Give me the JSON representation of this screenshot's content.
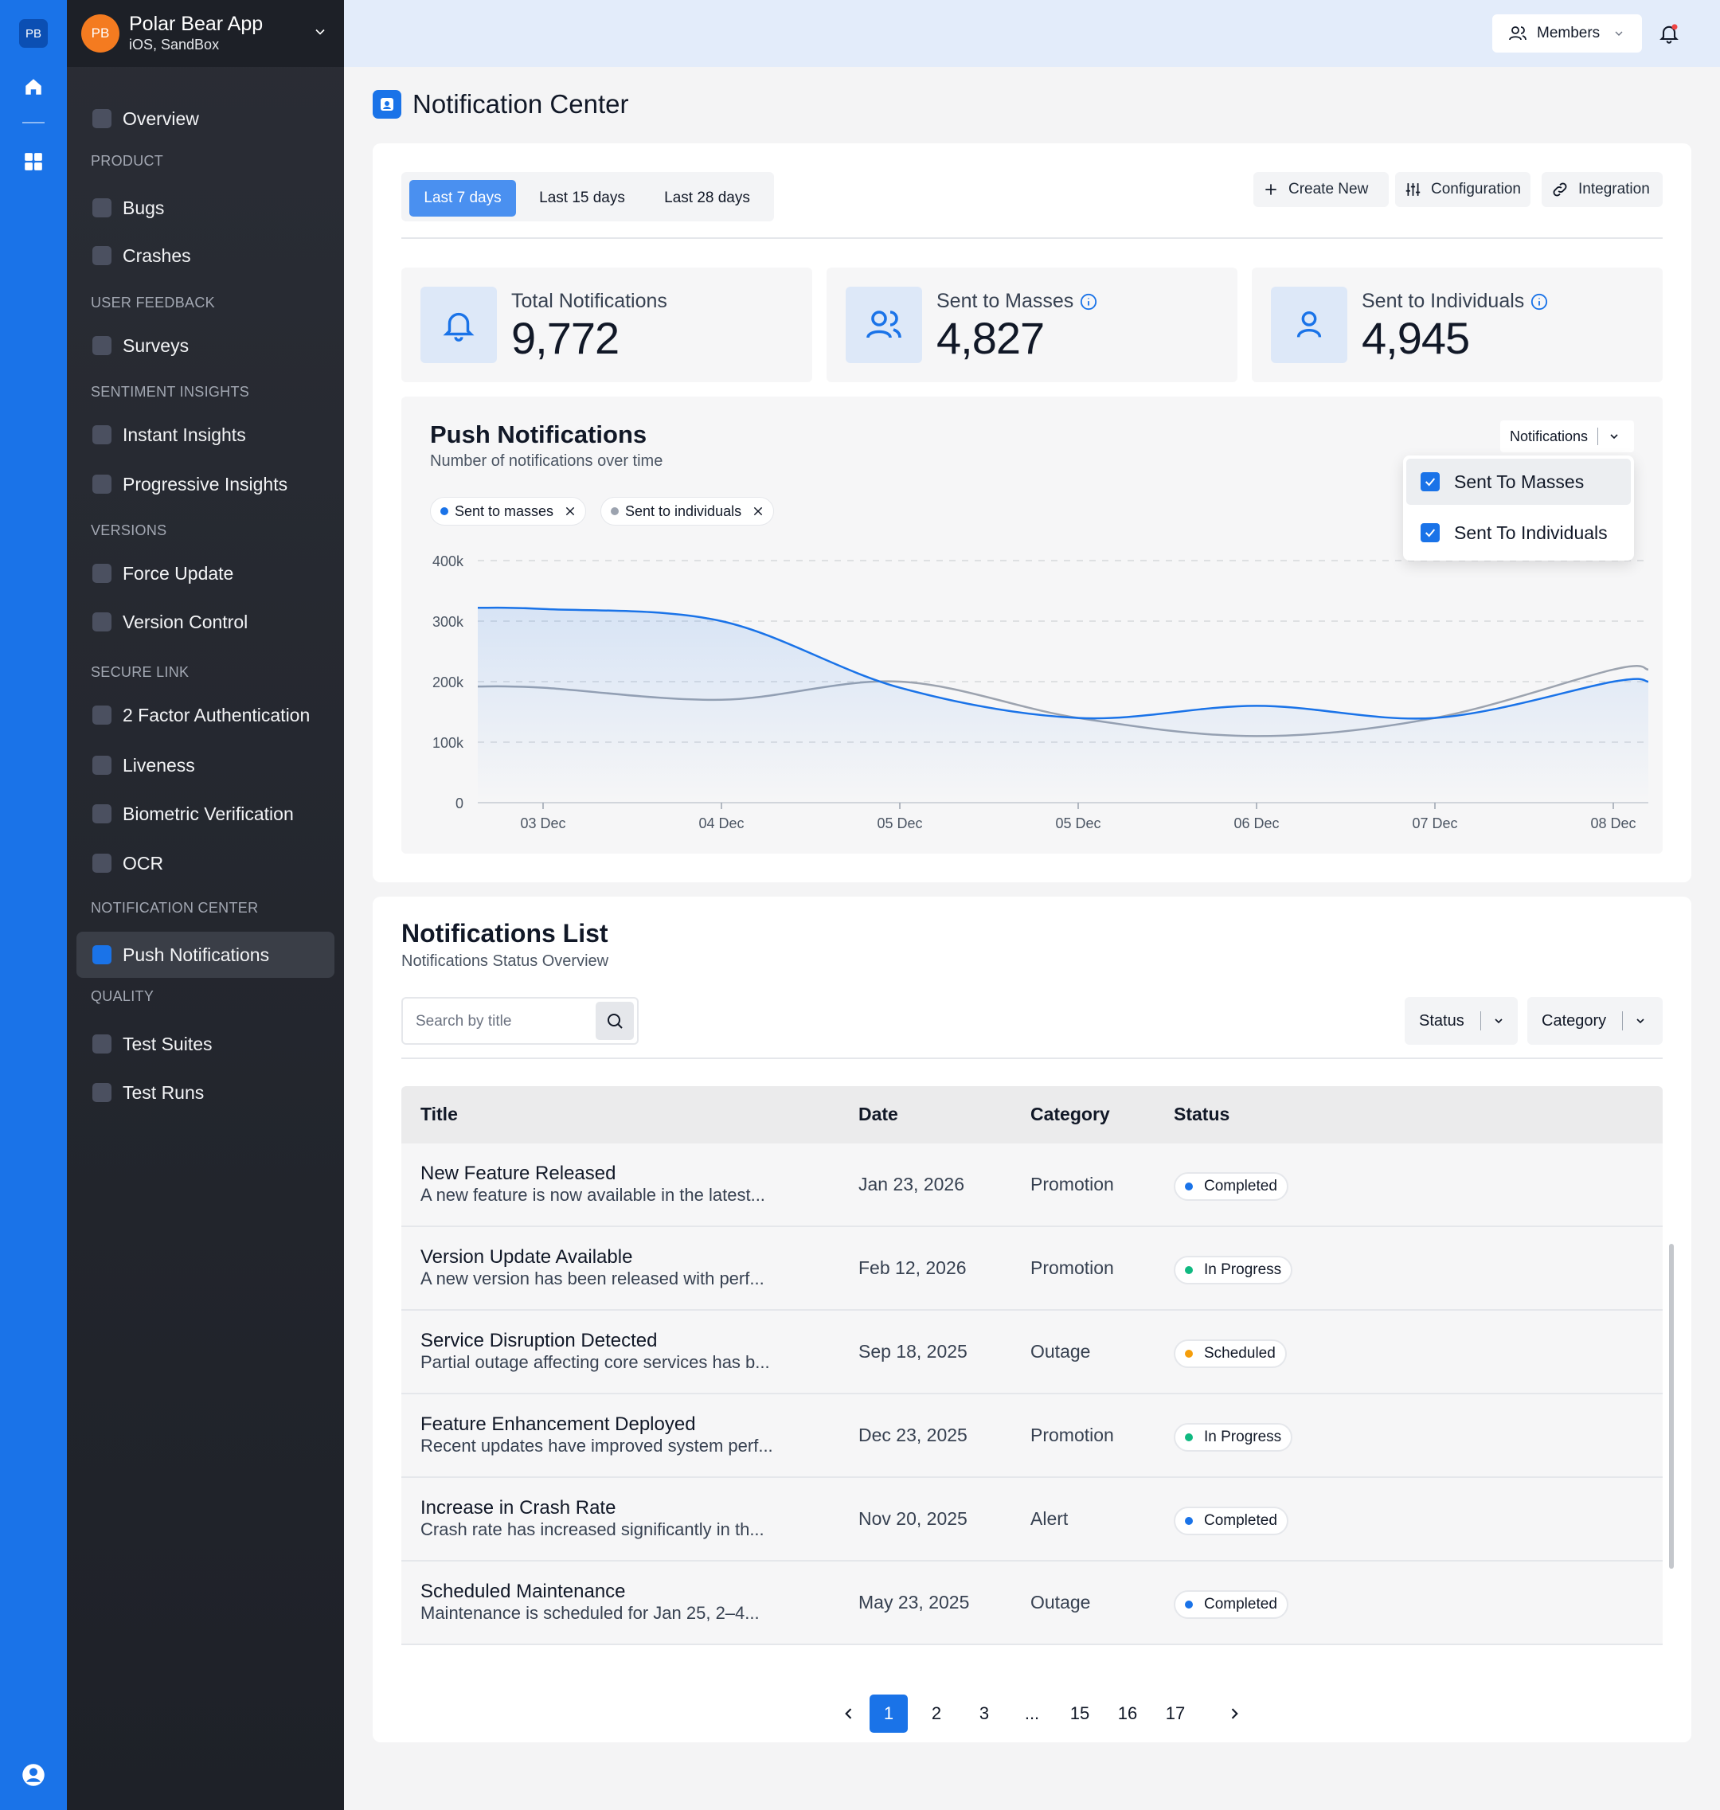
{
  "rail": {
    "logo": "PB",
    "items": [
      "home-icon",
      "grid-icon"
    ],
    "bottom": "user-circle-icon"
  },
  "app": {
    "name": "Polar Bear App",
    "env": "iOS, SandBox",
    "avatar": "PB"
  },
  "sidebar": {
    "overview": "Overview",
    "sections": [
      {
        "title": "PRODUCT",
        "items": [
          "Bugs",
          "Crashes"
        ]
      },
      {
        "title": "USER FEEDBACK",
        "items": [
          "Surveys"
        ]
      },
      {
        "title": "SENTIMENT INSIGHTS",
        "items": [
          "Instant Insights",
          "Progressive Insights"
        ]
      },
      {
        "title": "VERSIONS",
        "items": [
          "Force Update",
          "Version Control"
        ]
      },
      {
        "title": "SECURE LINK",
        "items": [
          "2 Factor Authentication",
          "Liveness",
          "Biometric Verification",
          "OCR"
        ]
      },
      {
        "title": "NOTIFICATION CENTER",
        "items": [
          "Push Notifications"
        ]
      },
      {
        "title": "QUALITY",
        "items": [
          "Test Suites",
          "Test Runs"
        ]
      }
    ],
    "active": "Push Notifications"
  },
  "topbar": {
    "members_label": "Members"
  },
  "page": {
    "title": "Notification Center"
  },
  "ranges": [
    "Last 7 days",
    "Last 15 days",
    "Last 28 days"
  ],
  "actions": {
    "create": "Create New",
    "config": "Configuration",
    "integration": "Integration"
  },
  "stats": [
    {
      "label": "Total Notifications",
      "value": "9,772",
      "icon": "bell-icon"
    },
    {
      "label": "Sent to Masses",
      "value": "4,827",
      "icon": "users-icon"
    },
    {
      "label": "Sent to Individuals",
      "value": "4,945",
      "icon": "user-icon"
    }
  ],
  "chart_panel": {
    "title": "Push Notifications",
    "subtitle": "Number of notifications over time",
    "select_label": "Notifications",
    "chips": [
      "Sent to masses",
      "Sent to individuals"
    ],
    "dropdown": [
      "Sent To Masses",
      "Sent To Individuals"
    ]
  },
  "chart_data": {
    "type": "line",
    "x": [
      "03 Dec",
      "04 Dec",
      "05 Dec",
      "05 Dec",
      "06 Dec",
      "07 Dec",
      "08 Dec"
    ],
    "yticks": [
      "400k",
      "300k",
      "200k",
      "100k",
      "0"
    ],
    "ylim": [
      0,
      400000
    ],
    "grid": true,
    "series": [
      {
        "name": "Sent to masses",
        "color": "#1a73e8",
        "values": [
          320000,
          300000,
          190000,
          140000,
          160000,
          140000,
          200000
        ]
      },
      {
        "name": "Sent to individuals",
        "color": "#9ca3af",
        "values": [
          190000,
          170000,
          200000,
          140000,
          110000,
          140000,
          220000
        ]
      }
    ]
  },
  "list": {
    "title": "Notifications List",
    "subtitle": "Notifications Status Overview",
    "search_placeholder": "Search by title",
    "filters": [
      "Status",
      "Category"
    ],
    "columns": [
      "Title",
      "Date",
      "Category",
      "Status"
    ],
    "rows": [
      {
        "title": "New Feature Released",
        "desc": "A new feature is now available in the latest...",
        "date": "Jan 23, 2026",
        "category": "Promotion",
        "status": "Completed",
        "status_color": "#1a73e8"
      },
      {
        "title": "Version Update Available",
        "desc": "A new version has been released with perf...",
        "date": "Feb 12, 2026",
        "category": "Promotion",
        "status": "In Progress",
        "status_color": "#10b981"
      },
      {
        "title": "Service Disruption Detected",
        "desc": "Partial outage affecting core services has b...",
        "date": "Sep 18, 2025",
        "category": "Outage",
        "status": "Scheduled",
        "status_color": "#f59e0b"
      },
      {
        "title": "Feature Enhancement Deployed",
        "desc": "Recent updates have improved system perf...",
        "date": "Dec 23, 2025",
        "category": "Promotion",
        "status": "In Progress",
        "status_color": "#10b981"
      },
      {
        "title": "Increase in Crash Rate",
        "desc": "Crash rate has increased significantly in th...",
        "date": "Nov 20, 2025",
        "category": "Alert",
        "status": "Completed",
        "status_color": "#1a73e8"
      },
      {
        "title": "Scheduled Maintenance",
        "desc": "Maintenance is scheduled for Jan 25, 2–4...",
        "date": "May 23, 2025",
        "category": "Outage",
        "status": "Completed",
        "status_color": "#1a73e8"
      }
    ],
    "pages": [
      "1",
      "2",
      "3",
      "...",
      "15",
      "16",
      "17"
    ],
    "current_page": "1"
  }
}
